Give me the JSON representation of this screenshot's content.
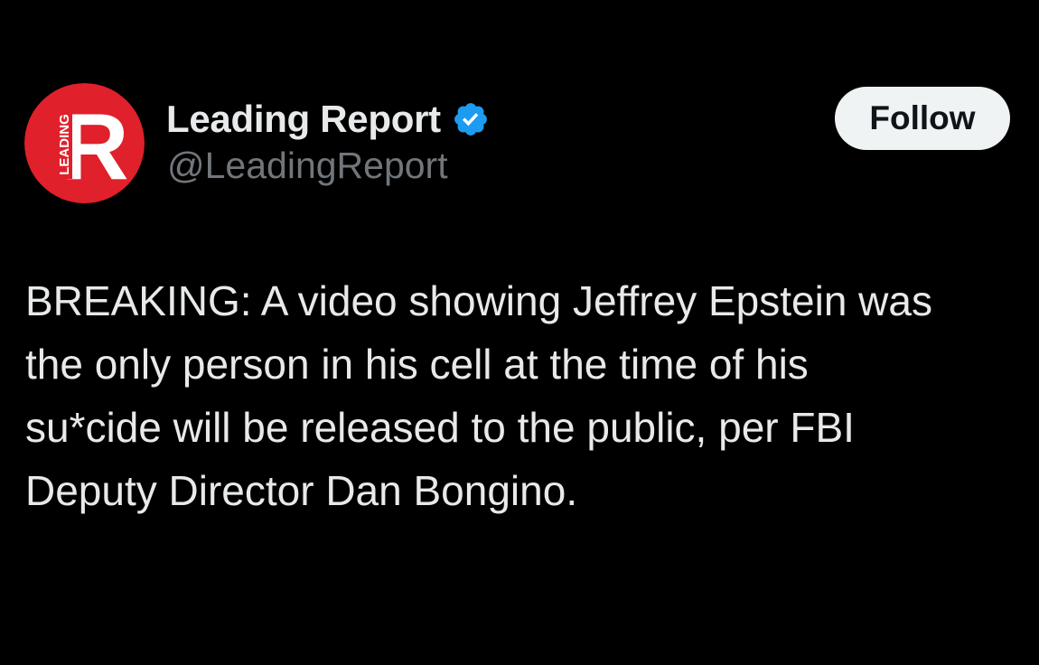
{
  "author": {
    "display_name": "Leading Report",
    "handle": "@LeadingReport",
    "avatar_logo_letter": "R",
    "avatar_logo_word": "LEADING",
    "avatar_icon": "leading-report-logo",
    "verified_icon": "verified-badge-icon",
    "verified": true
  },
  "actions": {
    "follow_label": "Follow"
  },
  "tweet": {
    "lines": [
      "BREAKING: A video showing Jeffrey Epstein was",
      "the only person in his cell at the time of his",
      "su*cide will be released to the public, per FBI",
      "Deputy Director Dan Bongino."
    ]
  },
  "colors": {
    "background": "#000000",
    "primary_text": "#e7e9ea",
    "secondary_text": "#71767b",
    "verified_blue": "#1d9bf0",
    "logo_red": "#e0202b",
    "follow_button_bg": "#eff3f4",
    "follow_button_text": "#0f1419"
  }
}
